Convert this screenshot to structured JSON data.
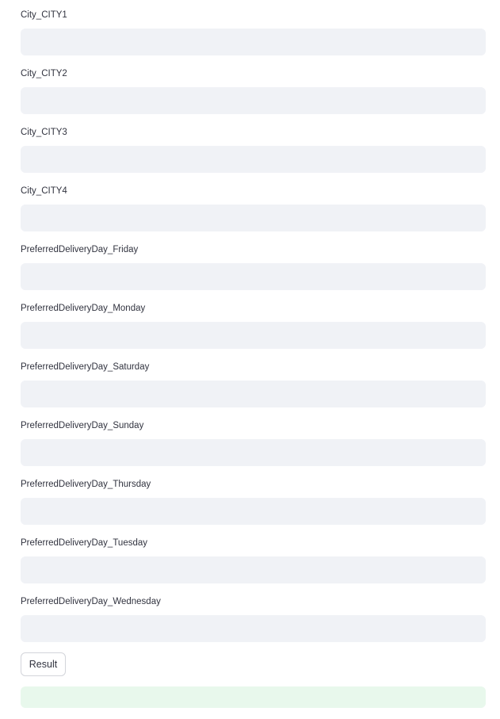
{
  "form": {
    "fields": [
      {
        "label": "City_CITY1",
        "value": ""
      },
      {
        "label": "City_CITY2",
        "value": ""
      },
      {
        "label": "City_CITY3",
        "value": ""
      },
      {
        "label": "City_CITY4",
        "value": ""
      },
      {
        "label": "PreferredDeliveryDay_Friday",
        "value": ""
      },
      {
        "label": "PreferredDeliveryDay_Monday",
        "value": ""
      },
      {
        "label": "PreferredDeliveryDay_Saturday",
        "value": ""
      },
      {
        "label": "PreferredDeliveryDay_Sunday",
        "value": ""
      },
      {
        "label": "PreferredDeliveryDay_Thursday",
        "value": ""
      },
      {
        "label": "PreferredDeliveryDay_Tuesday",
        "value": ""
      },
      {
        "label": "PreferredDeliveryDay_Wednesday",
        "value": ""
      }
    ],
    "submit_label": "Result",
    "result_text": ""
  },
  "colors": {
    "input_background": "#f0f2f6",
    "text": "#31333f",
    "button_border": "#d3d5da",
    "result_background": "#e8f8ec"
  }
}
